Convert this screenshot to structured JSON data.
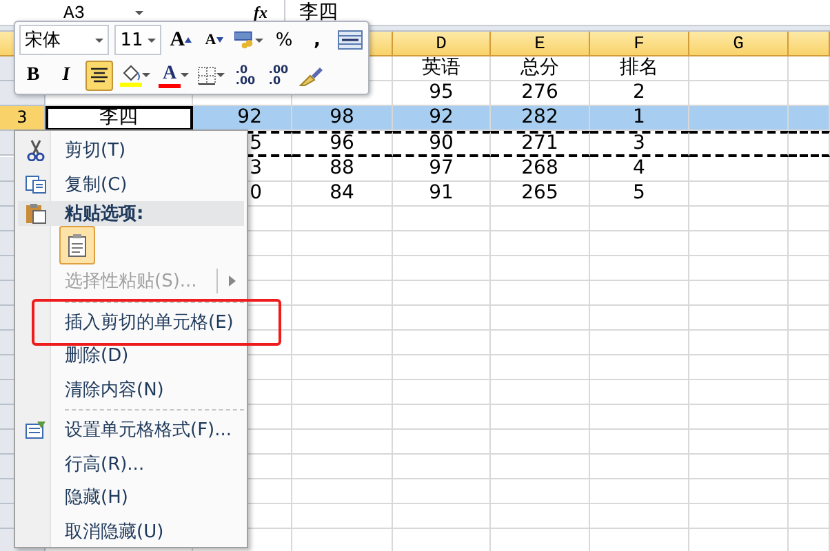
{
  "formula_bar": {
    "name_box": "A3",
    "fx": "fx",
    "value": "李四"
  },
  "column_headers": [
    "D",
    "E",
    "F",
    "G"
  ],
  "rows": [
    {
      "row_header": null,
      "selected": false,
      "cut": false,
      "cells": [
        null,
        null,
        null,
        "英语",
        "总分",
        "排名",
        null,
        null
      ]
    },
    {
      "row_header": null,
      "selected": false,
      "cut": false,
      "cells": [
        null,
        null,
        null,
        "95",
        "276",
        "2",
        null,
        null
      ]
    },
    {
      "row_header": "3",
      "selected": true,
      "cut": false,
      "cells": [
        "李四",
        "92",
        "98",
        "92",
        "282",
        "1",
        null,
        null
      ]
    },
    {
      "row_header": null,
      "selected": false,
      "cut": true,
      "cells": [
        null,
        "5",
        "96",
        "90",
        "271",
        "3",
        null,
        null
      ]
    },
    {
      "row_header": null,
      "selected": false,
      "cut": false,
      "cells": [
        null,
        "3",
        "88",
        "97",
        "268",
        "4",
        null,
        null
      ]
    },
    {
      "row_header": null,
      "selected": false,
      "cut": false,
      "cells": [
        null,
        "0",
        "84",
        "91",
        "265",
        "5",
        null,
        null
      ]
    }
  ],
  "mini_toolbar": {
    "font": "宋体",
    "size": "11",
    "grow_font": "A",
    "shrink_font": "A",
    "percent": "%",
    "comma": ",",
    "bold": "B",
    "italic": "I",
    "center_selected": true,
    "font_color_letter": "A",
    "increase_decimal": [
      ".0",
      ".00"
    ],
    "decrease_decimal": [
      ".00",
      ".0"
    ]
  },
  "context_menu": [
    {
      "kind": "cut",
      "label": "剪切(T)",
      "disabled": false,
      "submenu": false,
      "outlined": false
    },
    {
      "kind": "copy",
      "label": "复制(C)",
      "disabled": false,
      "submenu": false,
      "outlined": false
    },
    {
      "kind": "paste_header",
      "label": "粘贴选项:"
    },
    {
      "kind": "paste_option"
    },
    {
      "kind": "item",
      "label": "选择性粘贴(S)...",
      "disabled": true,
      "submenu": true,
      "outlined": false
    },
    {
      "kind": "separator"
    },
    {
      "kind": "item",
      "label": "插入剪切的单元格(E)",
      "disabled": false,
      "submenu": false,
      "outlined": true
    },
    {
      "kind": "item",
      "label": "删除(D)",
      "disabled": false,
      "submenu": false,
      "outlined": false
    },
    {
      "kind": "item",
      "label": "清除内容(N)",
      "disabled": false,
      "submenu": false,
      "outlined": false
    },
    {
      "kind": "separator"
    },
    {
      "kind": "format",
      "label": "设置单元格格式(F)...",
      "disabled": false,
      "submenu": false,
      "outlined": false
    },
    {
      "kind": "item",
      "label": "行高(R)...",
      "disabled": false,
      "submenu": false,
      "outlined": false
    },
    {
      "kind": "item",
      "label": "隐藏(H)",
      "disabled": false,
      "submenu": false,
      "outlined": false
    },
    {
      "kind": "item",
      "label": "取消隐藏(U)",
      "disabled": false,
      "submenu": false,
      "outlined": false
    }
  ]
}
